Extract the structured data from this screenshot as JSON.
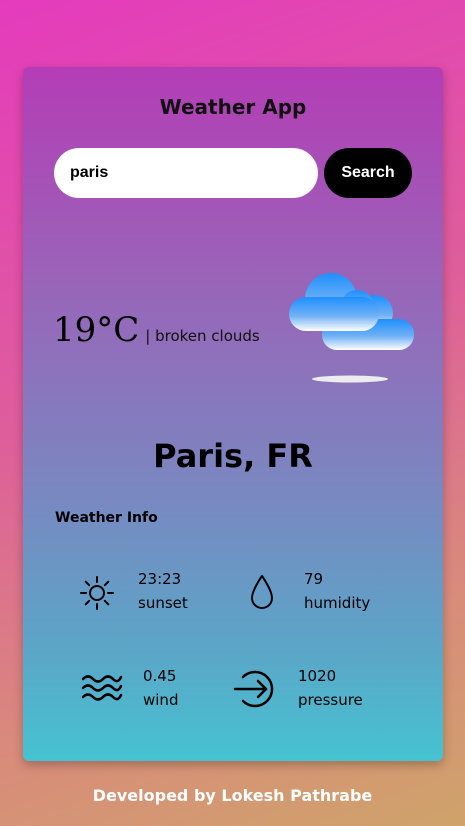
{
  "app": {
    "title": "Weather App"
  },
  "search": {
    "value": "paris",
    "button_label": "Search"
  },
  "current": {
    "temperature": "19°C",
    "description": "| broken clouds",
    "icon": "broken-clouds-icon",
    "city": "Paris, FR"
  },
  "info": {
    "title": "Weather Info",
    "items": [
      {
        "icon": "sun-icon",
        "value": "23:23",
        "label": "sunset"
      },
      {
        "icon": "droplet-icon",
        "value": "79",
        "label": "humidity"
      },
      {
        "icon": "wind-icon",
        "value": "0.45",
        "label": "wind"
      },
      {
        "icon": "pressure-icon",
        "value": "1020",
        "label": "pressure"
      }
    ]
  },
  "footer": {
    "text": "Developed by Lokesh Pathrabe"
  },
  "colors": {
    "card_top": "#b43db6",
    "card_bottom": "#45c3d1",
    "cloud_blue": "#1e90ff",
    "button_bg": "#000000"
  }
}
